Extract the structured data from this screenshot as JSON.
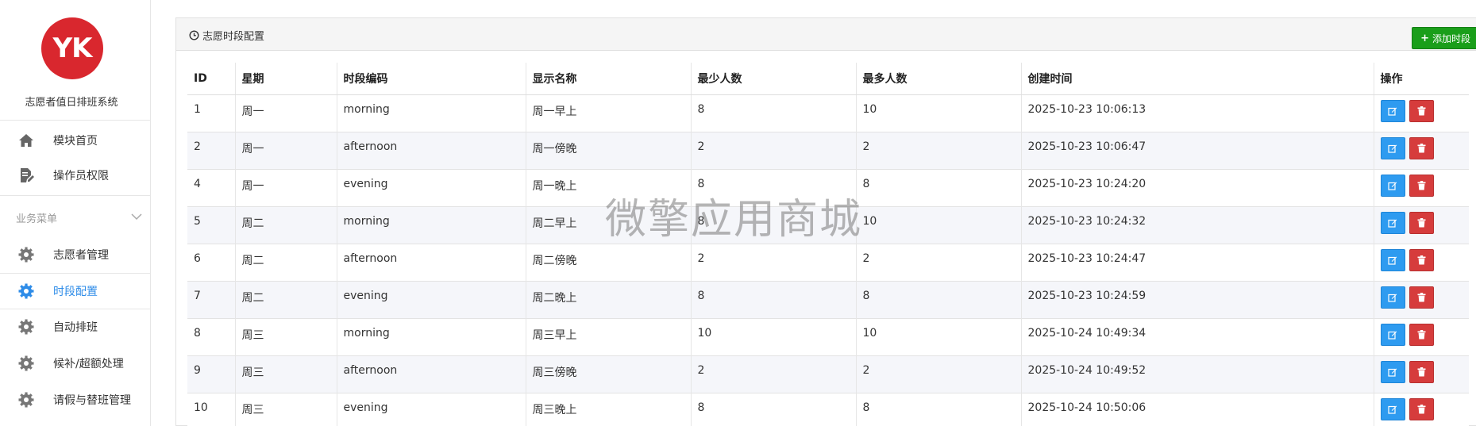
{
  "brand": {
    "logo_text": "YK",
    "title": "志愿者值日排班系统",
    "logo_color": "#d9272e"
  },
  "sidebar": {
    "top_items": [
      {
        "label": "模块首页",
        "icon": "home-icon"
      },
      {
        "label": "操作员权限",
        "icon": "document-edit-icon"
      }
    ],
    "group_label": "业务菜单",
    "group_items": [
      {
        "label": "志愿者管理",
        "icon": "gear-icon",
        "active": false
      },
      {
        "label": "时段配置",
        "icon": "gear-icon",
        "active": true
      },
      {
        "label": "自动排班",
        "icon": "gear-icon",
        "active": false
      },
      {
        "label": "候补/超额处理",
        "icon": "gear-icon",
        "active": false
      },
      {
        "label": "请假与替班管理",
        "icon": "gear-icon",
        "active": false
      }
    ],
    "active_color": "#2e8ce8"
  },
  "panel": {
    "title": "志愿时段配置",
    "add_button": "添加时段",
    "add_button_color": "#1a9e1a"
  },
  "table": {
    "columns": [
      "ID",
      "星期",
      "时段编码",
      "显示名称",
      "最少人数",
      "最多人数",
      "创建时间",
      "操作"
    ],
    "rows": [
      [
        "1",
        "周一",
        "morning",
        "周一早上",
        "8",
        "10",
        "2025-10-23 10:06:13"
      ],
      [
        "2",
        "周一",
        "afternoon",
        "周一傍晚",
        "2",
        "2",
        "2025-10-23 10:06:47"
      ],
      [
        "4",
        "周一",
        "evening",
        "周一晚上",
        "8",
        "8",
        "2025-10-23 10:24:20"
      ],
      [
        "5",
        "周二",
        "morning",
        "周二早上",
        "8",
        "10",
        "2025-10-23 10:24:32"
      ],
      [
        "6",
        "周二",
        "afternoon",
        "周二傍晚",
        "2",
        "2",
        "2025-10-23 10:24:47"
      ],
      [
        "7",
        "周二",
        "evening",
        "周二晚上",
        "8",
        "8",
        "2025-10-23 10:24:59"
      ],
      [
        "8",
        "周三",
        "morning",
        "周三早上",
        "10",
        "10",
        "2025-10-24 10:49:34"
      ],
      [
        "9",
        "周三",
        "afternoon",
        "周三傍晚",
        "2",
        "2",
        "2025-10-24 10:49:52"
      ],
      [
        "10",
        "周三",
        "evening",
        "周三晚上",
        "8",
        "8",
        "2025-10-24 10:50:06"
      ]
    ],
    "edit_color": "#2e9bf0",
    "delete_color": "#d63c3c"
  },
  "watermark": "微擎应用商城"
}
